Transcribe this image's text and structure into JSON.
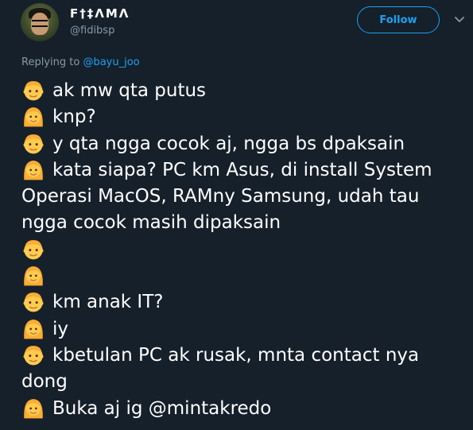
{
  "header": {
    "display_name": "F†‡ɅMΛ",
    "handle": "@fidibsp",
    "follow_label": "Follow"
  },
  "reply": {
    "prefix": "Replying to ",
    "mention": "@bayu_joo"
  },
  "tweet": {
    "lines": [
      {
        "emoji": "boy-emoji",
        "text": "ak mw qta putus"
      },
      {
        "emoji": "girl-emoji",
        "text": "knp?"
      },
      {
        "emoji": "boy-emoji",
        "text": "y qta ngga cocok aj, ngga bs dpaksain"
      },
      {
        "emoji": "girl-emoji",
        "text": "kata siapa? PC km Asus, di install System"
      },
      {
        "emoji": "",
        "text": "Operasi MacOS, RAMny Samsung, udah tau"
      },
      {
        "emoji": "",
        "text": "ngga cocok masih dipaksain"
      },
      {
        "emoji": "boy-emoji",
        "text": ""
      },
      {
        "emoji": "girl-emoji",
        "text": ""
      },
      {
        "emoji": "boy-emoji",
        "text": "km anak IT?"
      },
      {
        "emoji": "girl-emoji",
        "text": "iy"
      },
      {
        "emoji": "boy-emoji",
        "text": "kbetulan PC ak rusak, mnta contact nya"
      },
      {
        "emoji": "",
        "text": "dong"
      },
      {
        "emoji": "girl-emoji",
        "text": "Buka aj ig @mintakredo"
      }
    ]
  },
  "colors": {
    "background": "#15202b",
    "accent": "#1da1f2",
    "muted": "#8899a6"
  }
}
